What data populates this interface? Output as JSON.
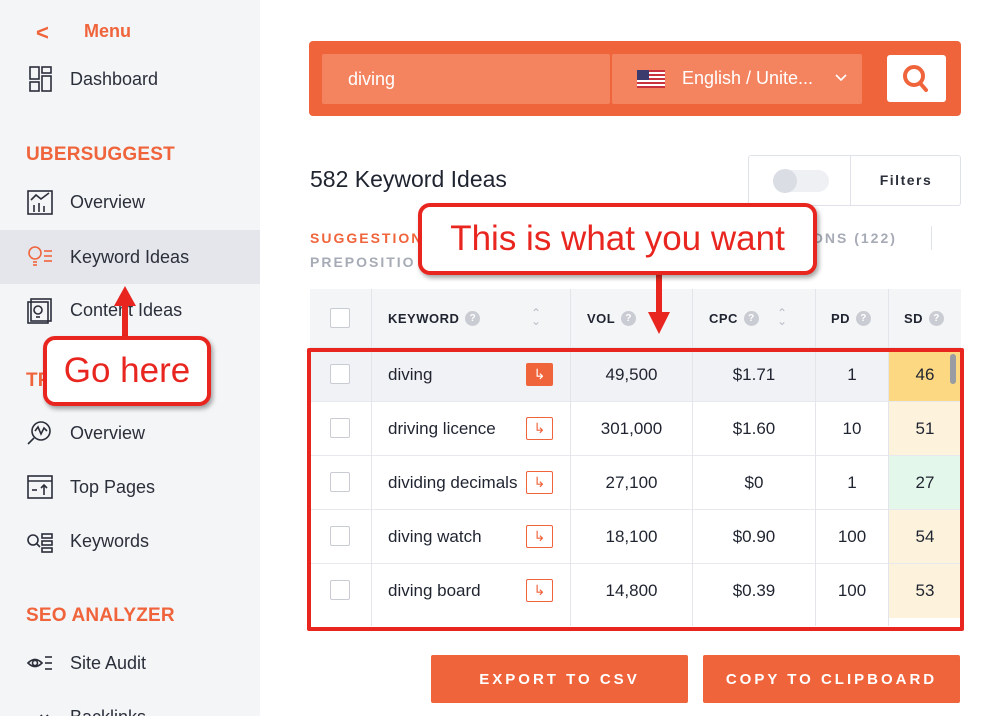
{
  "sidebar": {
    "back_icon": "chevron-left-icon",
    "menu_label": "Menu",
    "dashboard": "Dashboard",
    "section_ubersuggest": "UBERSUGGEST",
    "overview": "Overview",
    "keyword_ideas": "Keyword Ideas",
    "content_ideas": "Content Ideas",
    "section_traffic_partial": "TR",
    "traffic_overview": "Overview",
    "top_pages": "Top Pages",
    "keywords": "Keywords",
    "section_seo": "SEO ANALYZER",
    "site_audit": "Site Audit",
    "backlinks_partial": "Backlinks"
  },
  "search": {
    "value": "diving",
    "language": "English / Unite...",
    "flag_icon": "us-flag-icon",
    "button_icon": "search-icon"
  },
  "results": {
    "title": "582 Keyword Ideas",
    "filters_label": "Filters"
  },
  "tabs": {
    "suggestions": "SUGGESTION",
    "prepositions": "PREPOSITIO",
    "questions_partial": "ONS (122)"
  },
  "table": {
    "headers": {
      "keyword": "KEYWORD",
      "vol": "VOL",
      "cpc": "CPC",
      "pd": "PD",
      "sd": "SD"
    },
    "rows": [
      {
        "keyword": "diving",
        "vol": "49,500",
        "cpc": "$1.71",
        "pd": "1",
        "sd": "46",
        "sd_color": "#fcd882"
      },
      {
        "keyword": "driving licence",
        "vol": "301,000",
        "cpc": "$1.60",
        "pd": "10",
        "sd": "51",
        "sd_color": "#fdf3dd"
      },
      {
        "keyword": "dividing decimals",
        "vol": "27,100",
        "cpc": "$0",
        "pd": "1",
        "sd": "27",
        "sd_color": "#e3f8ea"
      },
      {
        "keyword": "diving watch",
        "vol": "18,100",
        "cpc": "$0.90",
        "pd": "100",
        "sd": "54",
        "sd_color": "#fdf3dd"
      },
      {
        "keyword": "diving board",
        "vol": "14,800",
        "cpc": "$0.39",
        "pd": "100",
        "sd": "53",
        "sd_color": "#fdf3dd"
      }
    ]
  },
  "actions": {
    "export_csv": "EXPORT TO CSV",
    "copy_clipboard": "COPY TO CLIPBOARD"
  },
  "annotations": {
    "top_callout": "This is what you want",
    "left_callout": "Go here",
    "color": "#e8261f"
  },
  "colors": {
    "accent": "#f0643c",
    "sidebar_bg": "#f4f5f7"
  }
}
